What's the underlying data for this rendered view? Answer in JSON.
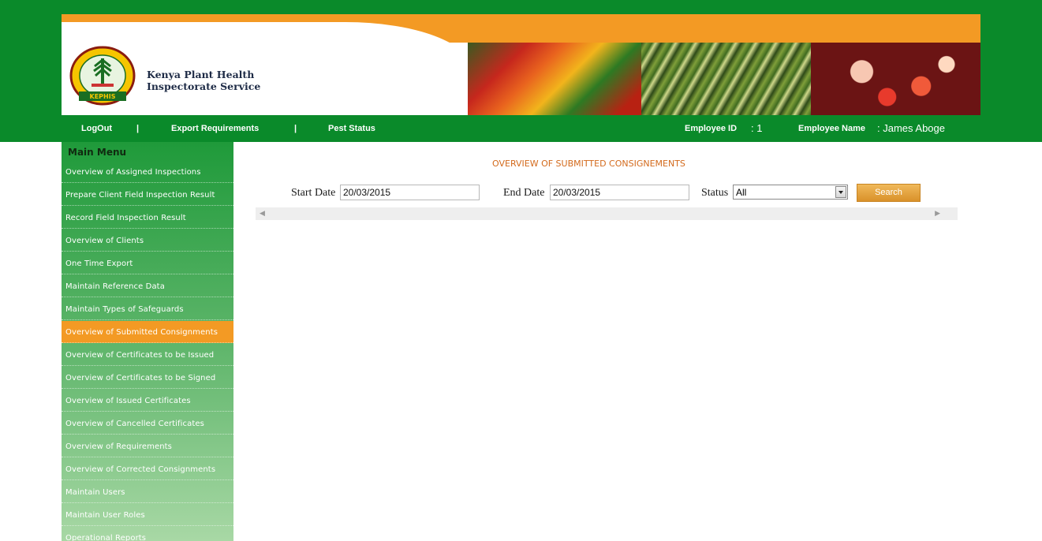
{
  "header": {
    "org_line1": "Kenya Plant Health",
    "org_line2": "Inspectorate Service",
    "logo_text": "KEPHIS"
  },
  "nav": {
    "logout": "LogOut",
    "sep1": "|",
    "export_requirements": "Export Requirements",
    "sep2": "|",
    "pest_status": "Pest Status",
    "employee_id_label": "Employee ID",
    "employee_id_value": ":   1",
    "employee_name_label": "Employee Name",
    "employee_name_value": ": James Aboge"
  },
  "sidebar": {
    "title": "Main Menu",
    "items": [
      {
        "label": "Overview of Assigned Inspections"
      },
      {
        "label": "Prepare Client Field Inspection Result"
      },
      {
        "label": "Record Field Inspection Result"
      },
      {
        "label": "Overview of Clients"
      },
      {
        "label": "One Time Export"
      },
      {
        "label": "Maintain Reference Data"
      },
      {
        "label": "Maintain Types of Safeguards"
      },
      {
        "label": "Overview of Submitted Consignments"
      },
      {
        "label": "Overview of Certificates to be Issued"
      },
      {
        "label": "Overview of Certificates to be Signed"
      },
      {
        "label": "Overview of Issued Certificates"
      },
      {
        "label": "Overview of Cancelled Certificates"
      },
      {
        "label": "Overview of Requirements"
      },
      {
        "label": "Overview of Corrected Consignments"
      },
      {
        "label": "Maintain Users"
      },
      {
        "label": "Maintain User Roles"
      },
      {
        "label": "Operational Reports"
      }
    ],
    "active_item": "Overview of Submitted Consignments"
  },
  "main": {
    "title": "OVERVIEW OF SUBMITTED CONSIGNEMENTS",
    "start_date_label": "Start Date",
    "start_date_value": "20/03/2015",
    "end_date_label": "End Date",
    "end_date_value": "20/03/2015",
    "status_label": "Status",
    "status_value": "All",
    "search_label": "Search"
  },
  "colors": {
    "brand_green": "#0a8a2a",
    "accent_orange": "#f39a24",
    "title_orange": "#d36a1c"
  }
}
